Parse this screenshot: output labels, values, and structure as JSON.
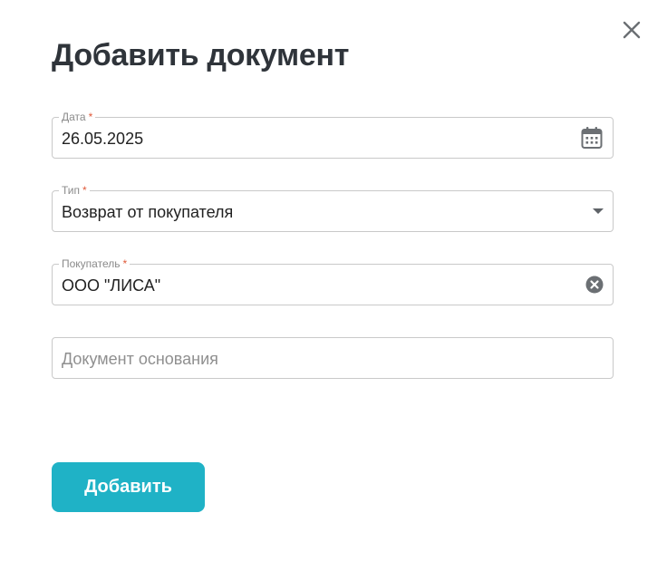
{
  "dialog": {
    "title": "Добавить документ",
    "close_icon": "close-icon"
  },
  "form": {
    "date": {
      "label": "Дата",
      "required_mark": "*",
      "value": "26.05.2025",
      "icon": "calendar-icon"
    },
    "type": {
      "label": "Тип",
      "required_mark": "*",
      "value": "Возврат от покупателя",
      "icon": "caret-down-icon"
    },
    "buyer": {
      "label": "Покупатель",
      "required_mark": "*",
      "value": "ООО \"ЛИСА\"",
      "icon": "clear-circle-icon"
    },
    "base_document": {
      "placeholder": "Документ основания",
      "value": ""
    }
  },
  "actions": {
    "submit_label": "Добавить"
  },
  "colors": {
    "accent": "#1fb2c6",
    "required": "#e05a3a",
    "title": "#2f343a",
    "border": "#c9c9c9"
  }
}
